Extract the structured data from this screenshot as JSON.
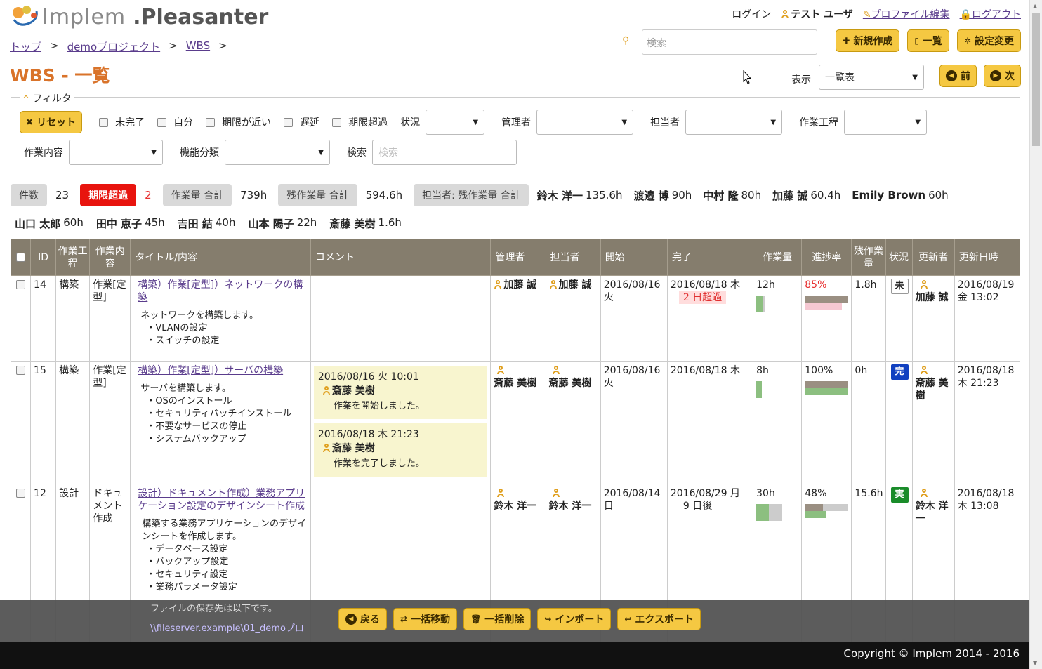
{
  "app": {
    "logo_text": "Implem",
    "product_name": ".Pleasanter"
  },
  "top_nav": {
    "login_label": "ログイン",
    "user_name": "テスト ユーザ",
    "profile_label": "プロファイル編集",
    "logout_label": "ログアウト"
  },
  "breadcrumb": [
    "トップ",
    "demoプロジェクト",
    "WBS"
  ],
  "breadcrumb_sep": ">",
  "search": {
    "placeholder": "検索"
  },
  "buttons": {
    "new": "新規作成",
    "list": "一覧",
    "settings": "設定変更",
    "prev": "前",
    "next": "次"
  },
  "page_title": "WBS - 一覧",
  "view": {
    "label": "表示",
    "selected": "一覧表"
  },
  "filter": {
    "legend": "フィルタ",
    "reset": "リセット",
    "checks": [
      "未完了",
      "自分",
      "期限が近い",
      "遅延",
      "期限超過"
    ],
    "status_label": "状況",
    "manager_label": "管理者",
    "owner_label": "担当者",
    "process_label": "作業工程",
    "content_label": "作業内容",
    "function_label": "機能分類",
    "search_label": "検索",
    "search_placeholder": "検索"
  },
  "summary": {
    "count_label": "件数",
    "count": "23",
    "overdue_label": "期限超過",
    "overdue": "2",
    "work_total_label": "作業量 合計",
    "work_total": "739h",
    "remain_total_label": "残作業量 合計",
    "remain_total": "594.6h",
    "owner_remain_label": "担当者: 残作業量 合計",
    "owners": [
      {
        "name": "鈴木 洋一",
        "hours": "135.6h"
      },
      {
        "name": "渡邉 博",
        "hours": "90h"
      },
      {
        "name": "中村 隆",
        "hours": "80h"
      },
      {
        "name": "加藤 誠",
        "hours": "60.4h"
      },
      {
        "name": "Emily Brown",
        "hours": "60h"
      },
      {
        "name": "山口 太郎",
        "hours": "60h"
      },
      {
        "name": "田中 恵子",
        "hours": "45h"
      },
      {
        "name": "吉田 結",
        "hours": "40h"
      },
      {
        "name": "山本 陽子",
        "hours": "22h"
      },
      {
        "name": "斎藤 美樹",
        "hours": "1.6h"
      }
    ]
  },
  "columns": {
    "id": "ID",
    "process": "作業工程",
    "content": "作業内容",
    "title": "タイトル/内容",
    "comment": "コメント",
    "manager": "管理者",
    "owner": "担当者",
    "start": "開始",
    "end": "完了",
    "work": "作業量",
    "progress": "進捗率",
    "remain": "残作業量",
    "status": "状況",
    "updater": "更新者",
    "updated": "更新日時"
  },
  "rows": [
    {
      "id": "14",
      "process": "構築",
      "content": "作業[定型]",
      "title": "構築）作業[定型]）ネットワークの構築",
      "desc": [
        "ネットワークを構築します。",
        "・VLANの設定",
        "・スイッチの設定"
      ],
      "manager": "加藤 誠",
      "owner": "加藤 誠",
      "start": "2016/08/16 火",
      "end": "2016/08/18 木",
      "end_note": "2 日超過",
      "work": "12h",
      "progress": "85%",
      "progress_value": 0.85,
      "remain": "1.8h",
      "status": "未",
      "updater": "加藤 誠",
      "updated": "2016/08/19 金 13:02"
    },
    {
      "id": "15",
      "process": "構築",
      "content": "作業[定型]",
      "title": "構築）作業[定型]）サーバの構築",
      "desc": [
        "サーバを構築します。",
        "・OSのインストール",
        "・セキュリティパッチインストール",
        "・不要なサービスの停止",
        "・システムバックアップ"
      ],
      "comments": [
        {
          "time": "2016/08/16 火 10:01",
          "user": "斎藤 美樹",
          "text": "作業を開始しました。"
        },
        {
          "time": "2016/08/18 木 21:23",
          "user": "斎藤 美樹",
          "text": "作業を完了しました。"
        }
      ],
      "manager": "斎藤 美樹",
      "owner": "斎藤 美樹",
      "start": "2016/08/16 火",
      "end": "2016/08/18 木",
      "work": "8h",
      "progress": "100%",
      "progress_value": 1.0,
      "remain": "0h",
      "status": "完",
      "updater": "斎藤 美樹",
      "updated": "2016/08/18 木 21:23"
    },
    {
      "id": "12",
      "process": "設計",
      "content": "ドキュメント作成",
      "title": "設計）ドキュメント作成）業務アプリケーション設定のデザインシート作成",
      "desc": [
        "構築する業務アプリケーションのデザインシートを作成します。",
        "・データベース設定",
        "・バックアップ設定",
        "・セキュリティ設定",
        "・業務パラメータ設定"
      ],
      "desc_more": [
        "ファイルの保存先は以下です。",
        "\\\\fileserver.example\\01_demoプロ"
      ],
      "manager": "鈴木 洋一",
      "owner": "鈴木 洋一",
      "start": "2016/08/14 日",
      "end": "2016/08/29 月",
      "end_note": "9 日後",
      "work": "30h",
      "progress": "48%",
      "progress_value": 0.48,
      "remain": "15.6h",
      "status": "実",
      "updater": "鈴木 洋一",
      "updated": "2016/08/18 木 13:08"
    }
  ],
  "footer_buttons": {
    "back": "戻る",
    "bulk_move": "一括移動",
    "bulk_delete": "一括削除",
    "import": "インポート",
    "export": "エクスポート"
  },
  "copyright": "Copyright © Implem 2014 - 2016"
}
